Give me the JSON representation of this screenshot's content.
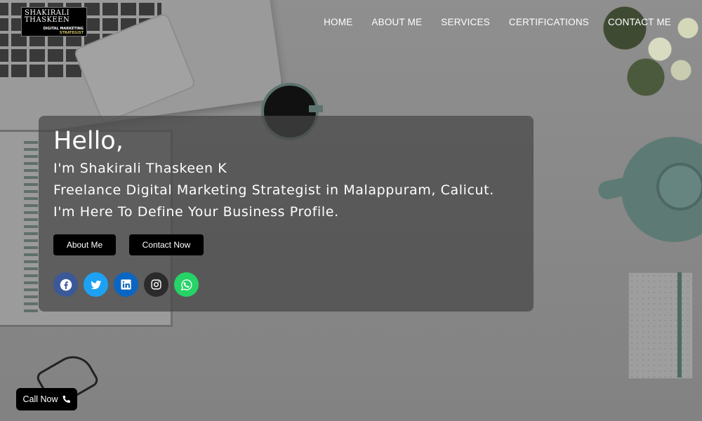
{
  "logo": {
    "line1": "SHAKIRALI",
    "line2": "THASKEEN",
    "sub1": "DIGITAL MARKETING",
    "sub2": "STRATEGIST"
  },
  "nav": {
    "items": [
      {
        "label": "HOME"
      },
      {
        "label": "ABOUT ME"
      },
      {
        "label": "SERVICES"
      },
      {
        "label": "CERTIFICATIONS"
      },
      {
        "label": "CONTACT ME"
      }
    ]
  },
  "hero": {
    "greeting": "Hello,",
    "intro": "I'm Shakirali Thaskeen K",
    "role": "Freelance Digital Marketing Strategist in Malappuram, Calicut.",
    "tagline": "I'm Here To Define Your Business Profile.",
    "buttons": {
      "about": "About Me",
      "contact": "Contact Now"
    },
    "social": [
      {
        "icon": "facebook-icon",
        "color": "#3b5998"
      },
      {
        "icon": "twitter-icon",
        "color": "#1da1f2"
      },
      {
        "icon": "linkedin-icon",
        "color": "#0a66c2"
      },
      {
        "icon": "instagram-icon",
        "color": "#2b2b2b"
      },
      {
        "icon": "whatsapp-icon",
        "color": "#25d366"
      }
    ]
  },
  "call_now": {
    "label": "Call Now",
    "icon": "phone-icon"
  }
}
